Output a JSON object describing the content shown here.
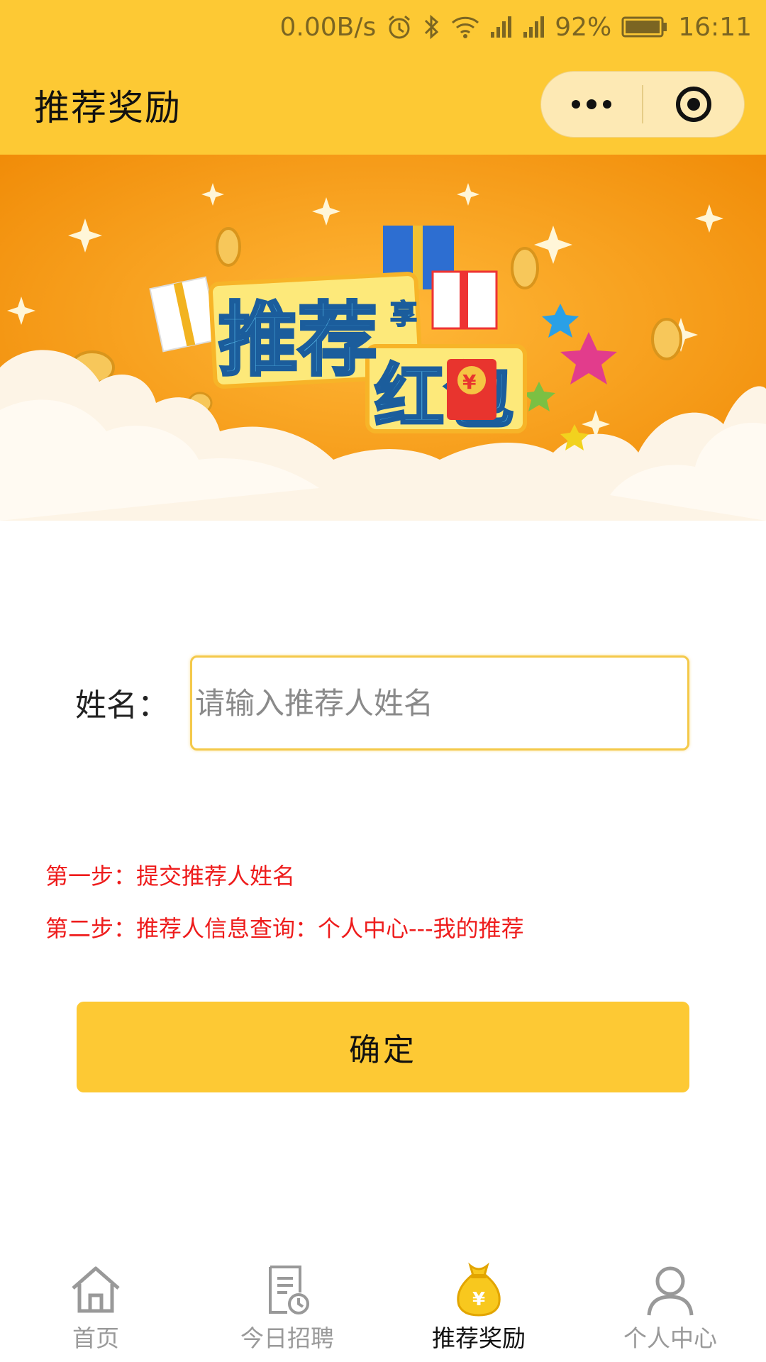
{
  "status_bar": {
    "net_speed": "0.00B/s",
    "battery": "92%",
    "time": "16:11"
  },
  "navbar": {
    "title": "推荐奖励"
  },
  "banner": {
    "title_line1": "推荐",
    "small_char": "享",
    "title_line2": "红包",
    "currency_symbol": "¥"
  },
  "form": {
    "name_label": "姓名：",
    "name_placeholder": "请输入推荐人姓名",
    "name_value": ""
  },
  "steps": [
    "第一步：提交推荐人姓名",
    "第二步：推荐人信息查询：个人中心---我的推荐"
  ],
  "confirm_label": "确定",
  "tabs": [
    {
      "label": "首页",
      "icon": "home-icon",
      "active": false
    },
    {
      "label": "今日招聘",
      "icon": "document-clock-icon",
      "active": false
    },
    {
      "label": "推荐奖励",
      "icon": "money-bag-icon",
      "active": true
    },
    {
      "label": "个人中心",
      "icon": "user-icon",
      "active": false
    }
  ],
  "colors": {
    "accent": "#fdc934",
    "step_text": "#ee1c1c",
    "banner_orange": "#f59a12"
  }
}
